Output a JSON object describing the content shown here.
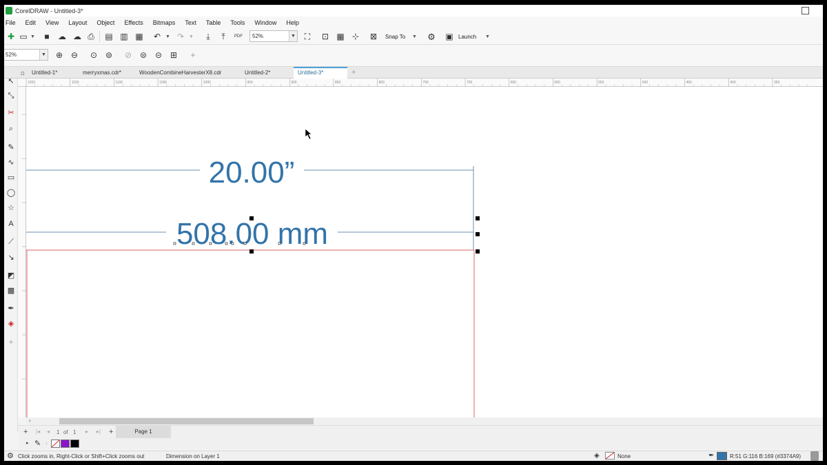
{
  "app": {
    "title": "CorelDRAW - Untitled-3*"
  },
  "menu": [
    "File",
    "Edit",
    "View",
    "Layout",
    "Object",
    "Effects",
    "Bitmaps",
    "Text",
    "Table",
    "Tools",
    "Window",
    "Help"
  ],
  "toolbar": {
    "zoom_value": "52%",
    "snap_to_label": "Snap To",
    "launch_label": "Launch",
    "pdf_label": "PDF"
  },
  "property_bar": {
    "zoom_value": "52%"
  },
  "tabs": [
    {
      "label": "Untitled-1*",
      "active": false
    },
    {
      "label": "merryxmas.cdr*",
      "active": false
    },
    {
      "label": "WoodenCombineHarvesterX8.cdr",
      "active": false
    },
    {
      "label": "Untitled-2*",
      "active": false
    },
    {
      "label": "Untitled-3*",
      "active": true
    }
  ],
  "ruler": {
    "h_ticks": [
      "1200",
      "1150",
      "1100",
      "1050",
      "1000",
      "950",
      "900",
      "850",
      "800",
      "750",
      "700",
      "650",
      "600",
      "550",
      "500",
      "450",
      "400",
      "350"
    ]
  },
  "canvas": {
    "dimension_top": "20.00”",
    "dimension_bottom": "508.00 mm"
  },
  "page_nav": {
    "current": "1",
    "of_label": "of",
    "total": "1",
    "page_tab": "Page 1"
  },
  "palette": {
    "colors": [
      "#8a14c8",
      "#000000"
    ]
  },
  "status": {
    "hint": "Click zooms in, Right-Click or Shift+Click zooms out",
    "object_info": "Dimension on Layer 1",
    "fill_label": "None",
    "outline_color": "#3374A9",
    "outline_label": "R:51 G:116 B:169 (#3374A9)"
  }
}
